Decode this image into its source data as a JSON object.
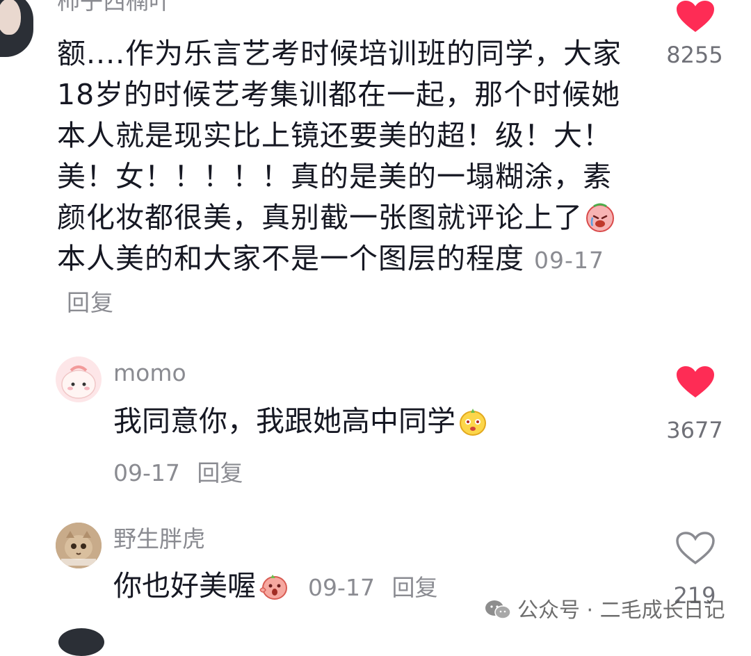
{
  "comments": [
    {
      "username": "柿子西楠叶",
      "text_part1": "额....作为乐言艺考时候培训班的同学，大家18岁的时候艺考集训都在一起，那个时候她本人就是现实比上镜还要美的超！级！大！美！女！！！！！真的是美的一塌糊涂，素颜化妆都很美，真别截一张图就评论上了",
      "emoji1": "crying-face-emoji",
      "text_part2": "本人美的和大家不是一个图层的程度",
      "date": "09-17",
      "reply_label": "回复",
      "likes": "8255",
      "liked": true
    },
    {
      "username": "momo",
      "text": "我同意你，我跟她高中同学",
      "emoji": "smirk-potato-emoji",
      "date": "09-17",
      "reply_label": "回复",
      "likes": "3677",
      "liked": true
    },
    {
      "username": "野生胖虎",
      "text": "你也好美喔",
      "emoji": "shocked-peach-emoji",
      "date": "09-17",
      "reply_label": "回复",
      "likes": "219",
      "liked": false
    }
  ],
  "watermark": {
    "icon": "wechat-icon",
    "text": "公众号 · 二毛成长日记"
  },
  "colors": {
    "like_red": "#fe2c55",
    "meta_gray": "#8a8b91",
    "text_dark": "#161823"
  }
}
